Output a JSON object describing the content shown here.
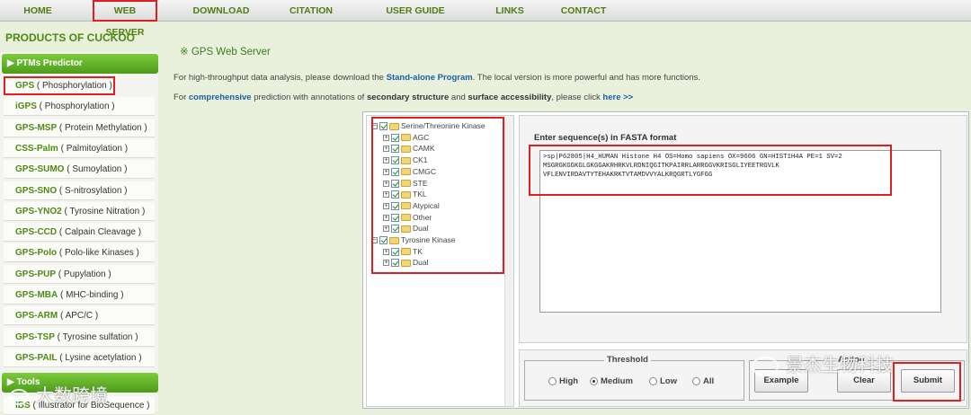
{
  "nav": {
    "home": "HOME",
    "web_server": "WEB SERVER",
    "download": "DOWNLOAD",
    "citation": "CITATION",
    "user_guide": "USER GUIDE",
    "links": "LINKS",
    "contact": "CONTACT"
  },
  "brand": "PRODUCTS OF CUCKOO",
  "sidebar": {
    "section_ptm": "PTMs Predictor",
    "section_tools": "Tools",
    "items": [
      {
        "name": "GPS",
        "desc": "Phosphorylation"
      },
      {
        "name": "iGPS",
        "desc": "Phosphorylation"
      },
      {
        "name": "GPS-MSP",
        "desc": "Protein Methylation"
      },
      {
        "name": "CSS-Palm",
        "desc": "Palmitoylation"
      },
      {
        "name": "GPS-SUMO",
        "desc": "Sumoylation"
      },
      {
        "name": "GPS-SNO",
        "desc": "S-nitrosylation"
      },
      {
        "name": "GPS-YNO2",
        "desc": "Tyrosine Nitration"
      },
      {
        "name": "GPS-CCD",
        "desc": "Calpain Cleavage"
      },
      {
        "name": "GPS-Polo",
        "desc": "Polo-like Kinases"
      },
      {
        "name": "GPS-PUP",
        "desc": "Pupylation"
      },
      {
        "name": "GPS-MBA",
        "desc": "MHC-binding"
      },
      {
        "name": "GPS-ARM",
        "desc": "APC/C"
      },
      {
        "name": "GPS-TSP",
        "desc": "Tyrosine sulfation"
      },
      {
        "name": "GPS-PAIL",
        "desc": "Lysine acetylation"
      }
    ],
    "tool_item": {
      "name": "IBS",
      "desc": "Illustrator for BioSequence"
    }
  },
  "page_title": "※ GPS Web Server",
  "para1": {
    "pre": "For high-throughput data analysis, please download the ",
    "link": "Stand-alone Program",
    "post": ". The local version is more powerful and has more functions."
  },
  "para2": {
    "pre": "For ",
    "link1": "comprehensive",
    "mid1": " prediction with annotations of ",
    "b1": "secondary structure",
    "mid2": " and ",
    "b2": "surface accessibility",
    "mid3": ", please click ",
    "link2": "here >>"
  },
  "tree": {
    "group1": "Serine/Threonine Kinase",
    "group1_items": [
      "AGC",
      "CAMK",
      "CK1",
      "CMGC",
      "STE",
      "TKL",
      "Atypical",
      "Other",
      "Dual"
    ],
    "group2": "Tyrosine Kinase",
    "group2_items": [
      "TK",
      "Dual"
    ]
  },
  "sequence": {
    "label": "Enter sequence(s) in FASTA format",
    "value": ">sp|P62805|H4_HUMAN Histone H4 OS=Homo sapiens OX=9606 GN=HIST1H4A PE=1 SV=2\nMSGRGKGGKGLGKGGAKRHRKVLRDNIQGITKPAIRRLARRGGVKRISGLIYEETRGVLK\nVFLENVIRDAVTYTEHAKRKTVTAMDVVYALKRQGRTLYGFGG"
  },
  "threshold": {
    "label": "Threshold",
    "options": [
      "High",
      "Medium",
      "Low",
      "All"
    ],
    "selected": "Medium"
  },
  "actions": {
    "label": "Action",
    "example": "Example",
    "clear": "Clear",
    "submit": "Submit"
  },
  "watermarks": {
    "right": "景杰生物科技",
    "left": "大数跨境"
  },
  "colors": {
    "accent_green": "#4e9b1c",
    "highlight_red": "#e02020",
    "link_blue": "#1a5ea8"
  }
}
